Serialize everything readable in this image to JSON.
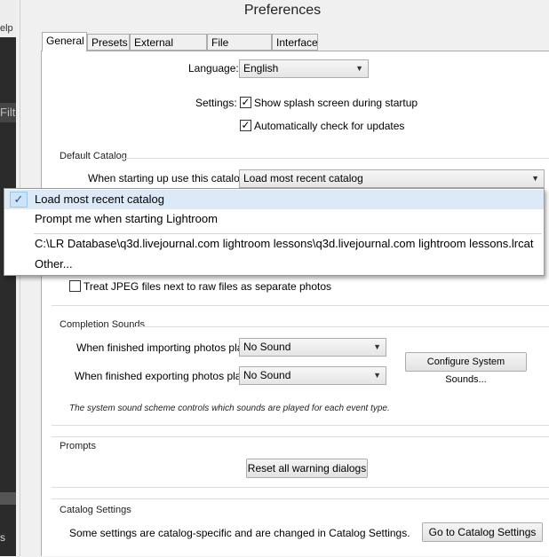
{
  "window": {
    "title": "Preferences"
  },
  "background_app": {
    "help_text": "elp",
    "filter_text": "Filt",
    "footer_text": "s ▼"
  },
  "tabs": [
    {
      "label": "General"
    },
    {
      "label": "Presets"
    },
    {
      "label": "External Editing"
    },
    {
      "label": "File Handling"
    },
    {
      "label": "Interface"
    }
  ],
  "general": {
    "language_label": "Language:",
    "language_value": "English",
    "settings_label": "Settings:",
    "splash_label": "Show splash screen during startup",
    "updates_label": "Automatically check for updates",
    "default_catalog_header": "Default Catalog",
    "startup_catalog_label": "When starting up use this catalog:",
    "startup_catalog_value": "Load most recent catalog",
    "treat_jpeg_label": "Treat JPEG files next to raw files as separate photos",
    "completion_sounds_header": "Completion Sounds",
    "import_sound_label": "When finished importing photos play:",
    "import_sound_value": "No Sound",
    "export_sound_label": "When finished exporting photos play:",
    "export_sound_value": "No Sound",
    "configure_sounds_button": "Configure System Sounds...",
    "sounds_note": "The system sound scheme controls which sounds are played for each event type.",
    "prompts_header": "Prompts",
    "reset_warnings_button": "Reset all warning dialogs",
    "catalog_settings_header": "Catalog Settings",
    "catalog_settings_text": "Some settings are catalog-specific and are changed in Catalog Settings.",
    "goto_catalog_button": "Go to Catalog Settings"
  },
  "catalog_dropdown": {
    "options": [
      "Load most recent catalog",
      "Prompt me when starting Lightroom",
      "C:\\LR Database\\q3d.livejournal.com lightroom lessons\\q3d.livejournal.com lightroom lessons.lrcat",
      "Other..."
    ],
    "selected": "Load most recent catalog"
  },
  "checks": {
    "splash": true,
    "updates": true,
    "treat_jpeg": false
  }
}
